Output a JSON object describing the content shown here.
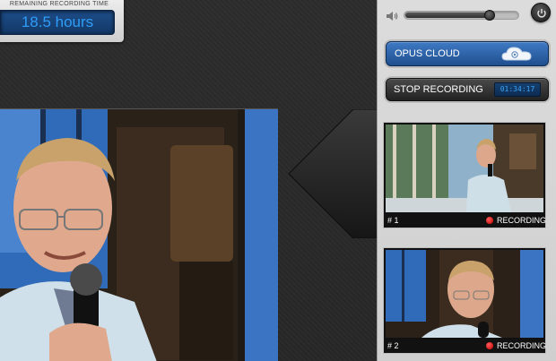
{
  "recording_time": {
    "label": "REMAINING RECORDING TIME",
    "value": "18.5 hours"
  },
  "controls": {
    "volume_level": 0.75,
    "volume_icon": "speaker-icon",
    "power_icon": "power-icon",
    "cloud_button_label": "OPUS CLOUD",
    "cloud_icon": "cloud-icon",
    "stop_button_label": "STOP RECORDING",
    "elapsed_time": "01:34:17"
  },
  "cameras": [
    {
      "number": "# 1",
      "status": "RECORDING",
      "selected": true
    },
    {
      "number": "# 2",
      "status": "RECORDING",
      "selected": false
    }
  ],
  "colors": {
    "accent_blue": "#2f9cf5",
    "recording_red": "#d60000",
    "cloud_button": "#2a5ea4"
  }
}
